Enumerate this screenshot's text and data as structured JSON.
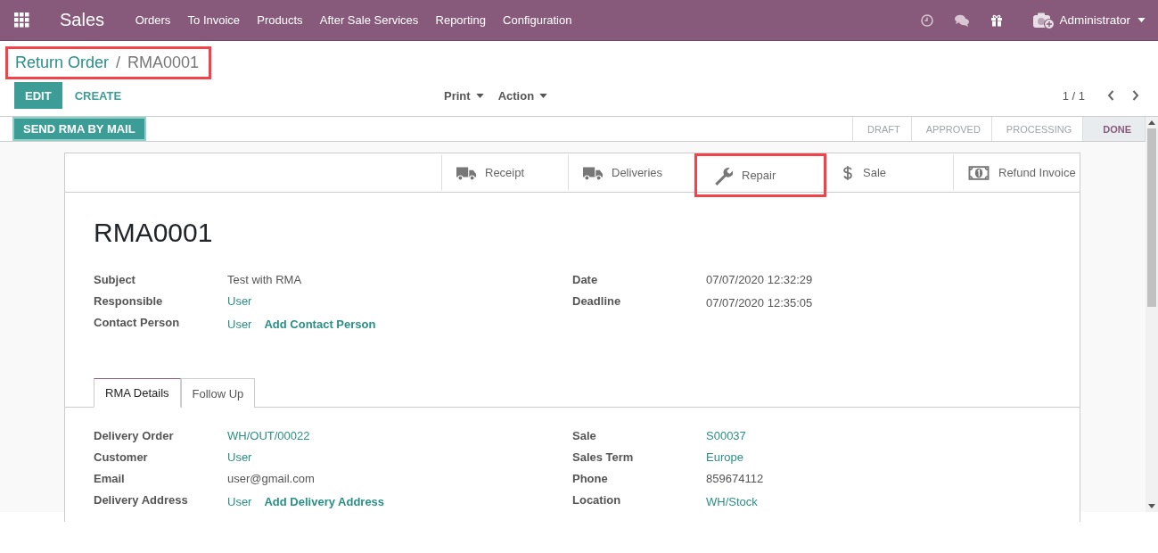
{
  "navbar": {
    "app": "Sales",
    "menu": [
      "Orders",
      "To Invoice",
      "Products",
      "After Sale Services",
      "Reporting",
      "Configuration"
    ],
    "user": "Administrator"
  },
  "breadcrumb": {
    "parent": "Return Order",
    "separator": "/",
    "current": "RMA0001",
    "highlighted": true
  },
  "toolbar": {
    "primary": "EDIT",
    "secondary": "CREATE",
    "dropdowns": [
      "Print",
      "Action"
    ],
    "pager": "1 / 1"
  },
  "header_buttons": [
    "SEND RMA BY MAIL"
  ],
  "stages": [
    {
      "label": "DRAFT",
      "selected": false
    },
    {
      "label": "APPROVED",
      "selected": false
    },
    {
      "label": "PROCESSING",
      "selected": false
    },
    {
      "label": "DONE",
      "selected": true
    }
  ],
  "smart_buttons": [
    {
      "label": "Receipt",
      "kind": "truck",
      "highlighted": false
    },
    {
      "label": "Deliveries",
      "kind": "truck",
      "highlighted": false
    },
    {
      "label": "Repair",
      "kind": "wrench",
      "highlighted": true
    },
    {
      "label": "Sale",
      "kind": "dollar",
      "highlighted": false
    },
    {
      "label": "Refund Invoice",
      "kind": "money",
      "highlighted": false
    }
  ],
  "title": "RMA0001",
  "main_fields": {
    "left": [
      {
        "label": "Subject",
        "value": "Test with RMA",
        "kind": "text"
      },
      {
        "label": "Responsible",
        "value": "User",
        "kind": "link"
      },
      {
        "label": "Contact Person",
        "value": "User",
        "kind": "link",
        "action": "Add Contact Person"
      }
    ],
    "right": [
      {
        "label": "Date",
        "value": "07/07/2020 12:32:29",
        "kind": "text"
      },
      {
        "label": "Deadline",
        "value": "07/07/2020 12:35:05",
        "kind": "text"
      }
    ]
  },
  "tabs": [
    {
      "label": "RMA Details",
      "selected": true
    },
    {
      "label": "Follow Up",
      "selected": false
    }
  ],
  "tab_fields": {
    "left": [
      {
        "label": "Delivery Order",
        "value": "WH/OUT/00022",
        "kind": "link"
      },
      {
        "label": "Customer",
        "value": "User",
        "kind": "link"
      },
      {
        "label": "Email",
        "value": "user@gmail.com",
        "kind": "text"
      },
      {
        "label": "Delivery Address",
        "value": "User",
        "kind": "link",
        "action": "Add Delivery Address"
      }
    ],
    "right": [
      {
        "label": "Sale",
        "value": "S00037",
        "kind": "link"
      },
      {
        "label": "Sales Term",
        "value": "Europe",
        "kind": "link"
      },
      {
        "label": "Phone",
        "value": "859674112",
        "kind": "text"
      },
      {
        "label": "Location",
        "value": "WH/Stock",
        "kind": "link"
      }
    ]
  }
}
